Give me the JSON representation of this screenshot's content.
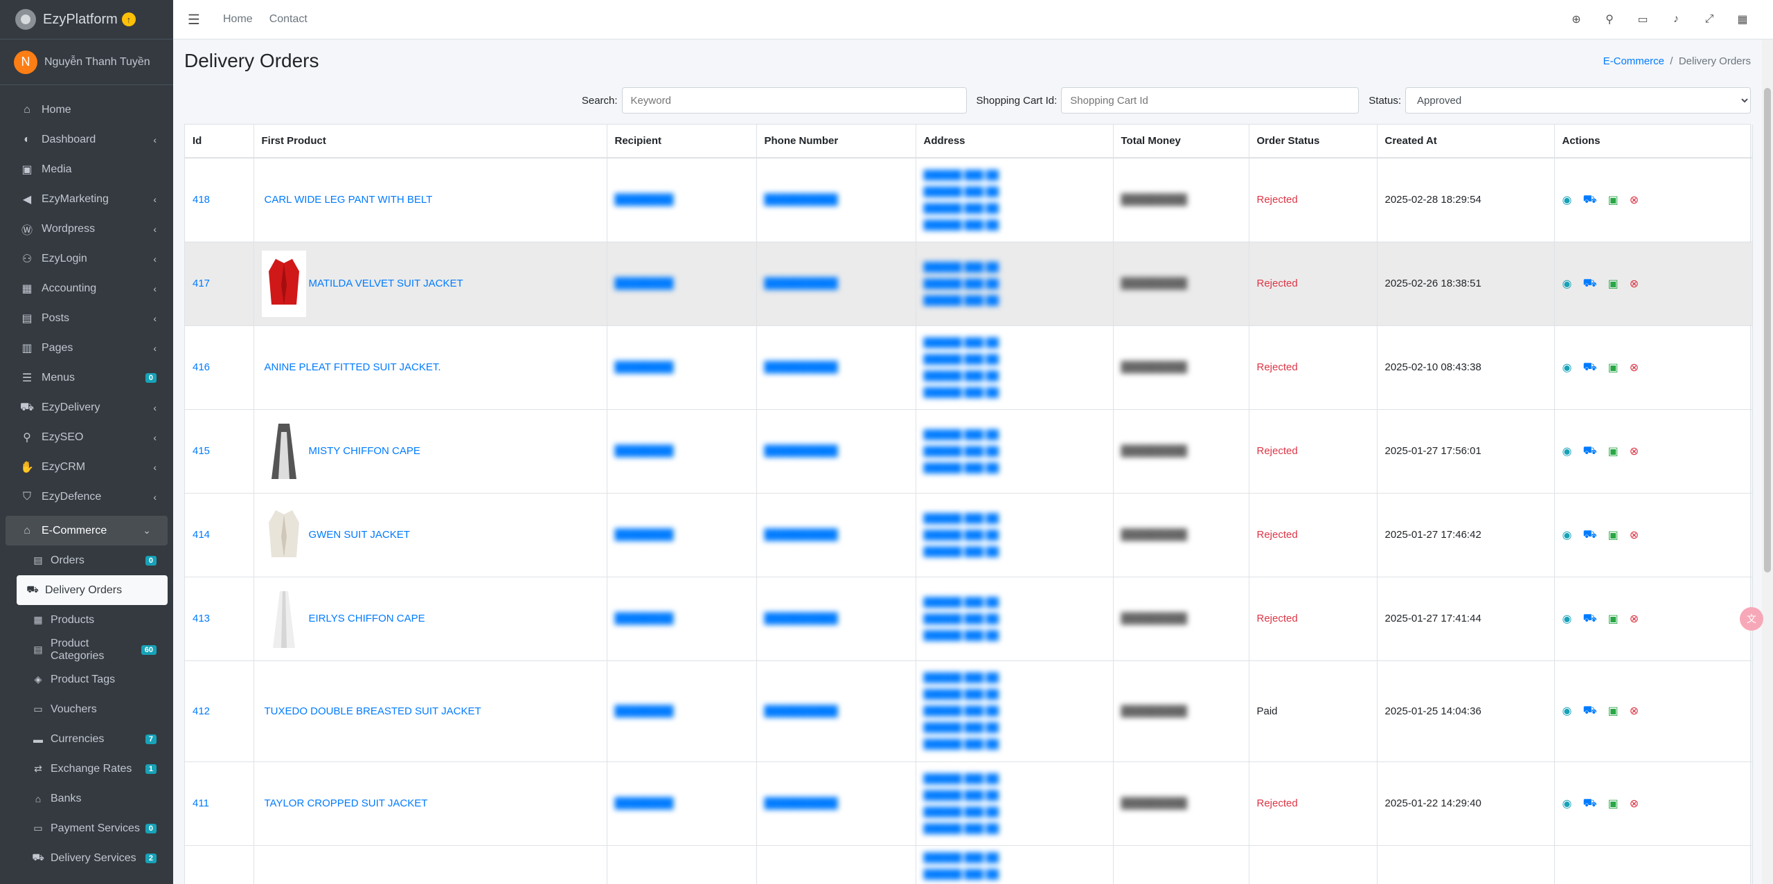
{
  "brand": {
    "name": "EzyPlatform",
    "badge": "↑"
  },
  "user": {
    "initial": "N",
    "name": "Nguyễn Thanh Tuyền"
  },
  "sidebar": {
    "items": [
      {
        "label": "Home",
        "icon": "home-icon",
        "glyph": "⌂",
        "chevron": false
      },
      {
        "label": "Dashboard",
        "icon": "dashboard-icon",
        "glyph": "◐",
        "chevron": true
      },
      {
        "label": "Media",
        "icon": "image-icon",
        "glyph": "▣",
        "chevron": false
      },
      {
        "label": "EzyMarketing",
        "icon": "megaphone-icon",
        "glyph": "◀",
        "chevron": true
      },
      {
        "label": "Wordpress",
        "icon": "wordpress-icon",
        "glyph": "Ⓦ",
        "chevron": true
      },
      {
        "label": "EzyLogin",
        "icon": "user-lock-icon",
        "glyph": "⚇",
        "chevron": true
      },
      {
        "label": "Accounting",
        "icon": "calculator-icon",
        "glyph": "▦",
        "chevron": true
      },
      {
        "label": "Posts",
        "icon": "newspaper-icon",
        "glyph": "▤",
        "chevron": true
      },
      {
        "label": "Pages",
        "icon": "book-icon",
        "glyph": "▥",
        "chevron": true
      },
      {
        "label": "Menus",
        "icon": "menu-icon",
        "glyph": "☰",
        "badge": "0"
      },
      {
        "label": "EzyDelivery",
        "icon": "truck-icon",
        "glyph": "⛟",
        "chevron": true
      },
      {
        "label": "EzySEO",
        "icon": "search-plus-icon",
        "glyph": "⚲",
        "chevron": true
      },
      {
        "label": "EzyCRM",
        "icon": "handshake-icon",
        "glyph": "✋",
        "chevron": true
      },
      {
        "label": "EzyDefence",
        "icon": "shield-icon",
        "glyph": "⛉",
        "chevron": true
      }
    ],
    "open_item": {
      "label": "E-Commerce",
      "icon": "store-icon",
      "glyph": "⌂"
    },
    "sub_items": [
      {
        "label": "Orders",
        "icon": "clipboard-icon",
        "glyph": "▤",
        "badge": "0"
      },
      {
        "label": "Delivery Orders",
        "icon": "dolly-icon",
        "glyph": "⛟",
        "active": true
      },
      {
        "label": "Products",
        "icon": "boxes-icon",
        "glyph": "▦"
      },
      {
        "label": "Product Categories",
        "icon": "list-icon",
        "glyph": "▤",
        "badge": "60"
      },
      {
        "label": "Product Tags",
        "icon": "tags-icon",
        "glyph": "◈"
      },
      {
        "label": "Vouchers",
        "icon": "ticket-icon",
        "glyph": "▭"
      },
      {
        "label": "Currencies",
        "icon": "money-icon",
        "glyph": "▬",
        "badge": "7"
      },
      {
        "label": "Exchange Rates",
        "icon": "exchange-icon",
        "glyph": "⇄",
        "badge": "1"
      },
      {
        "label": "Banks",
        "icon": "bank-icon",
        "glyph": "⌂"
      },
      {
        "label": "Payment Services",
        "icon": "credit-card-icon",
        "glyph": "▭",
        "badge": "0"
      },
      {
        "label": "Delivery Services",
        "icon": "truck-icon",
        "glyph": "⛟",
        "badge": "2"
      }
    ]
  },
  "topnav": {
    "home": "Home",
    "contact": "Contact"
  },
  "page": {
    "title": "Delivery Orders",
    "breadcrumb_parent": "E-Commerce",
    "breadcrumb_current": "Delivery Orders"
  },
  "filters": {
    "search_label": "Search:",
    "search_placeholder": "Keyword",
    "cart_label": "Shopping Cart Id:",
    "cart_placeholder": "Shopping Cart Id",
    "status_label": "Status:",
    "status_value": "Approved"
  },
  "table": {
    "headers": [
      "Id",
      "First Product",
      "Recipient",
      "Phone Number",
      "Address",
      "Total Money",
      "Order Status",
      "Created At",
      "Actions"
    ],
    "rows": [
      {
        "id": "418",
        "product": "CARL WIDE LEG PANT WITH BELT",
        "thumb": "",
        "status": "Rejected",
        "created": "2025-02-28 18:29:54",
        "height": 121,
        "addr_lines": 4
      },
      {
        "id": "417",
        "product": "MATILDA VELVET SUIT JACKET",
        "thumb": "red-jacket",
        "status": "Rejected",
        "created": "2025-02-26 18:38:51",
        "height": 121,
        "addr_lines": 3
      },
      {
        "id": "416",
        "product": "ANINE PLEAT FITTED SUIT JACKET.",
        "thumb": "",
        "status": "Rejected",
        "created": "2025-02-10 08:43:38",
        "height": 121,
        "addr_lines": 4
      },
      {
        "id": "415",
        "product": "MISTY CHIFFON CAPE",
        "thumb": "grey-cape",
        "status": "Rejected",
        "created": "2025-01-27 17:56:01",
        "height": 121,
        "addr_lines": 3
      },
      {
        "id": "414",
        "product": "GWEN SUIT JACKET",
        "thumb": "white-jacket",
        "status": "Rejected",
        "created": "2025-01-27 17:46:42",
        "height": 121,
        "addr_lines": 3
      },
      {
        "id": "413",
        "product": "EIRLYS CHIFFON CAPE",
        "thumb": "white-cape",
        "status": "Rejected",
        "created": "2025-01-27 17:41:44",
        "height": 121,
        "addr_lines": 3
      },
      {
        "id": "412",
        "product": "TUXEDO DOUBLE BREASTED SUIT JACKET",
        "thumb": "",
        "status": "Paid",
        "created": "2025-01-25 14:04:36",
        "height": 146,
        "addr_lines": 5
      },
      {
        "id": "411",
        "product": "TAYLOR CROPPED SUIT JACKET",
        "thumb": "",
        "status": "Rejected",
        "created": "2025-01-22 14:29:40",
        "height": 121,
        "addr_lines": 4
      },
      {
        "id": "",
        "product": "",
        "thumb": "",
        "status": "",
        "created": "",
        "height": 60,
        "addr_lines": 2
      }
    ]
  }
}
